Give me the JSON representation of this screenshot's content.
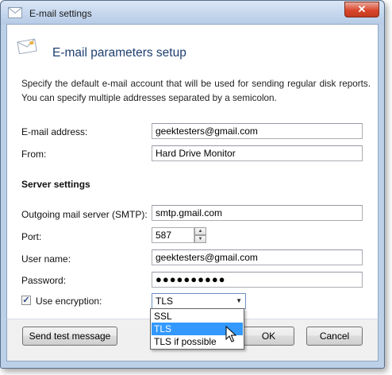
{
  "window": {
    "title": "E-mail settings",
    "close_glyph": "✕"
  },
  "header": {
    "title": "E-mail parameters setup",
    "icon": "envelope-icon"
  },
  "description": "Specify the default e-mail account that will be used for sending regular disk reports. You can specify multiple addresses separated by a semicolon.",
  "fields": {
    "email_label": "E-mail address:",
    "email_value": "geektesters@gmail.com",
    "from_label": "From:",
    "from_value": "Hard Drive Monitor"
  },
  "server": {
    "heading": "Server settings",
    "smtp_label": "Outgoing mail server (SMTP):",
    "smtp_value": "smtp.gmail.com",
    "port_label": "Port:",
    "port_value": "587",
    "user_label": "User name:",
    "user_value": "geektesters@gmail.com",
    "password_label": "Password:",
    "password_value": "●●●●●●●●●●"
  },
  "encryption": {
    "checkbox_checked": true,
    "check_glyph": "✓",
    "label": "Use encryption:",
    "selected": "TLS",
    "options": [
      "SSL",
      "TLS",
      "TLS if possible"
    ],
    "highlighted": "TLS"
  },
  "buttons": {
    "send_test": "Send test message",
    "ok": "OK",
    "cancel": "Cancel"
  },
  "glyphs": {
    "spin_up": "▲",
    "spin_down": "▼",
    "dropdown_arrow": "▼"
  },
  "colors": {
    "accent": "#3399ff",
    "title_blue": "#1e3e70",
    "close_red": "#d9472c"
  }
}
